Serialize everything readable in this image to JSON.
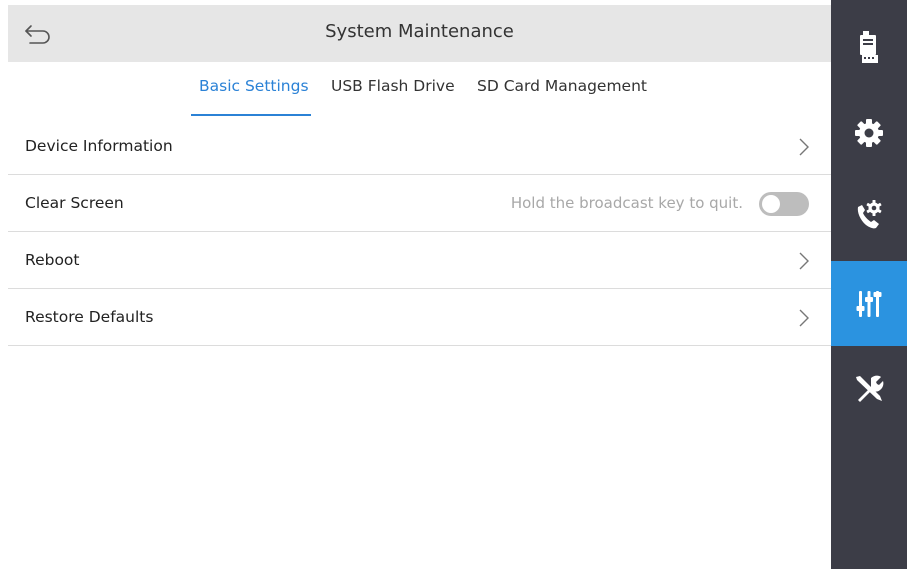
{
  "header": {
    "title": "System Maintenance"
  },
  "tabs": [
    {
      "label": "Basic Settings",
      "active": true
    },
    {
      "label": "USB Flash Drive",
      "active": false
    },
    {
      "label": "SD Card Management",
      "active": false
    }
  ],
  "rows": [
    {
      "label": "Device Information",
      "control": "chevron"
    },
    {
      "label": "Clear Screen",
      "control": "toggle",
      "hint": "Hold the broadcast key to quit.",
      "toggle_on": false
    },
    {
      "label": "Reboot",
      "control": "chevron"
    },
    {
      "label": "Restore Defaults",
      "control": "chevron"
    }
  ],
  "sidebar": {
    "items": [
      {
        "icon": "intercom-device-icon",
        "active": false
      },
      {
        "icon": "gear-icon",
        "active": false
      },
      {
        "icon": "call-settings-icon",
        "active": false
      },
      {
        "icon": "sliders-icon",
        "active": true
      },
      {
        "icon": "tools-icon",
        "active": false
      }
    ]
  },
  "colors": {
    "accent": "#2b82d6",
    "sidebar_bg": "#3c3d47",
    "sidebar_active": "#2b93e0",
    "header_bg": "#e6e6e6"
  }
}
